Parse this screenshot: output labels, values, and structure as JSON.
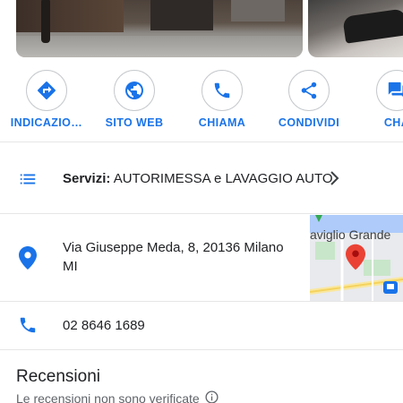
{
  "actions": [
    {
      "label": "INDICAZIO…",
      "icon": "directions-icon"
    },
    {
      "label": "SITO WEB",
      "icon": "globe-icon"
    },
    {
      "label": "CHIAMA",
      "icon": "phone-icon"
    },
    {
      "label": "CONDIVIDI",
      "icon": "share-icon"
    },
    {
      "label": "CHA",
      "icon": "chat-icon"
    }
  ],
  "services": {
    "label": "Servizi:",
    "value": "AUTORIMESSA e LAVAGGIO AUTO"
  },
  "address": {
    "line1": "Via Giuseppe Meda, 8, 20136 Milano",
    "line2": "MI"
  },
  "map": {
    "label": "aviglio Grande"
  },
  "phone": {
    "number": "02 8646 1689"
  },
  "reviews": {
    "title": "Recensioni",
    "subtitle": "Le recensioni non sono verificate"
  },
  "colors": {
    "accent": "#1a73e8",
    "pin": "#ea4335",
    "text": "#202124",
    "muted": "#5f6368"
  }
}
